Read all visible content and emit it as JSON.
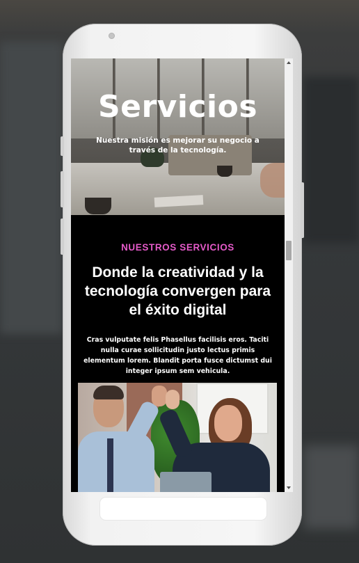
{
  "hero": {
    "title": "Servicios",
    "subtitle": "Nuestra misión es mejorar su negocio a través de la tecnología."
  },
  "services": {
    "eyebrow": "NUESTROS SERVICIOS",
    "headline": "Donde la creatividad y la tecnología convergen para el éxito digital",
    "body": "Cras vulputate felis Phasellus facilisis eros. Taciti nulla curae sollicitudin justo lectus primis elementum lorem. Blandit porta fusce dictumst dui integer ipsum sem vehicula."
  },
  "colors": {
    "accent": "#e55ac9",
    "page_background": "#000000",
    "phone_frame": "#f2f2f2"
  },
  "images": {
    "hero_image": "office-desk-photo",
    "team_image": "colleagues-high-five-photo"
  }
}
